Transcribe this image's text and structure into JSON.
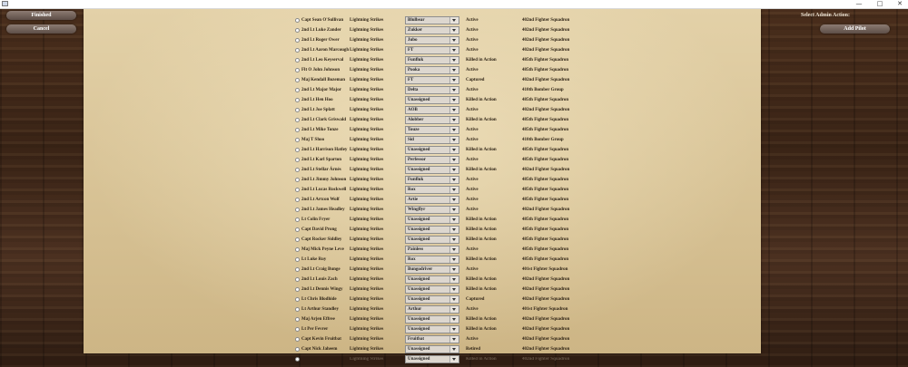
{
  "window": {
    "icon": "app-icon",
    "controls": {
      "minimize": "—",
      "maximize": "□",
      "close": "✕"
    }
  },
  "left_buttons": {
    "finished": "Finished",
    "cancel": "Cancel"
  },
  "admin": {
    "label": "Select Admin Action:",
    "add_pilot": "Add Pilot"
  },
  "roster": [
    {
      "name": "Capt Sean O'Sullivan",
      "unit": "Lightning Strikes",
      "callsign": "Blulbear",
      "status": "Active",
      "squadron": "402nd Fighter Squadron"
    },
    {
      "name": "2nd Lt Luke Zander",
      "unit": "Lightning Strikes",
      "callsign": "Zukker",
      "status": "Active",
      "squadron": "402nd Fighter Squadron"
    },
    {
      "name": "2nd Lt Roger Ower",
      "unit": "Lightning Strikes",
      "callsign": "Jubo",
      "status": "Active",
      "squadron": "402nd Fighter Squadron"
    },
    {
      "name": "2nd Lt Aaron Marcoughli",
      "unit": "Lightning Strikes",
      "callsign": "FT",
      "status": "Active",
      "squadron": "402nd Fighter Squadron"
    },
    {
      "name": "2nd Lt Leo Keyserval",
      "unit": "Lightning Strikes",
      "callsign": "Funfluk",
      "status": "Killed in Action",
      "squadron": "485th Fighter Squadron"
    },
    {
      "name": "Flt O John Johnson",
      "unit": "Lightning Strikes",
      "callsign": "Pooka",
      "status": "Active",
      "squadron": "485th Fighter Squadron"
    },
    {
      "name": "Maj Kendall Bozeman",
      "unit": "Lightning Strikes",
      "callsign": "FT",
      "status": "Captured",
      "squadron": "402nd Fighter Squadron"
    },
    {
      "name": "2nd Lt Major Major",
      "unit": "Lightning Strikes",
      "callsign": "Delta",
      "status": "Active",
      "squadron": "410th Bomber Group"
    },
    {
      "name": "2nd Lt Hen Hoo",
      "unit": "Lightning Strikes",
      "callsign": "Unassigned",
      "status": "Killed in Action",
      "squadron": "485th Fighter Squadron"
    },
    {
      "name": "2nd Lt Joe Splatt",
      "unit": "Lightning Strikes",
      "callsign": "AOB",
      "status": "Active",
      "squadron": "402nd Fighter Squadron"
    },
    {
      "name": "2nd Lt Clark Griswald",
      "unit": "Lightning Strikes",
      "callsign": "Alobber",
      "status": "Killed in Action",
      "squadron": "485th Fighter Squadron"
    },
    {
      "name": "2nd Lt Mike Tonze",
      "unit": "Lightning Strikes",
      "callsign": "Touze",
      "status": "Active",
      "squadron": "485th Fighter Squadron"
    },
    {
      "name": "Maj T Shoo",
      "unit": "Lightning Strikes",
      "callsign": "Sid",
      "status": "Active",
      "squadron": "410th Bomber Group"
    },
    {
      "name": "2nd Lt Harrison Hatley",
      "unit": "Lightning Strikes",
      "callsign": "Unassigned",
      "status": "Killed in Action",
      "squadron": "485th Fighter Squadron"
    },
    {
      "name": "2nd Lt Karl Sparton",
      "unit": "Lightning Strikes",
      "callsign": "Perfessor",
      "status": "Active",
      "squadron": "485th Fighter Squadron"
    },
    {
      "name": "2nd Lt Stellar Árnés",
      "unit": "Lightning Strikes",
      "callsign": "Unassigned",
      "status": "Killed in Action",
      "squadron": "402nd Fighter Squadron"
    },
    {
      "name": "2nd Lt Jimmy Johnson",
      "unit": "Lightning Strikes",
      "callsign": "Funfluk",
      "status": "Active",
      "squadron": "485th Fighter Squadron"
    },
    {
      "name": "2nd Lt Lucas Rockwell",
      "unit": "Lightning Strikes",
      "callsign": "Rox",
      "status": "Active",
      "squadron": "485th Fighter Squadron"
    },
    {
      "name": "2nd Lt Artcon Wolf",
      "unit": "Lightning Strikes",
      "callsign": "Artie",
      "status": "Active",
      "squadron": "485th Fighter Squadron"
    },
    {
      "name": "2nd Lt James Headley",
      "unit": "Lightning Strikes",
      "callsign": "Wingflyr",
      "status": "Active",
      "squadron": "402nd Fighter Squadron"
    },
    {
      "name": "Lt Colin Fryer",
      "unit": "Lightning Strikes",
      "callsign": "Unassigned",
      "status": "Killed in Action",
      "squadron": "485th Fighter Squadron"
    },
    {
      "name": "Capt David Prong",
      "unit": "Lightning Strikes",
      "callsign": "Unassigned",
      "status": "Killed in Action",
      "squadron": "485th Fighter Squadron"
    },
    {
      "name": "Capt Rocker Siddley",
      "unit": "Lightning Strikes",
      "callsign": "Unassigned",
      "status": "Killed in Action",
      "squadron": "485th Fighter Squadron"
    },
    {
      "name": "Maj Mick Peyne Leve",
      "unit": "Lightning Strikes",
      "callsign": "Painless",
      "status": "Active",
      "squadron": "485th Fighter Squadron"
    },
    {
      "name": "Lt Luke Roy",
      "unit": "Lightning Strikes",
      "callsign": "Rox",
      "status": "Killed in Action",
      "squadron": "485th Fighter Squadron"
    },
    {
      "name": "2nd Lt Craig Bunge",
      "unit": "Lightning Strikes",
      "callsign": "Bungodriver",
      "status": "Active",
      "squadron": "401st Fighter Squadron"
    },
    {
      "name": "2nd Lt Louis Zach",
      "unit": "Lightning Strikes",
      "callsign": "Unassigned",
      "status": "Killed in Action",
      "squadron": "402nd Fighter Squadron"
    },
    {
      "name": "2nd Lt Dennis Wingy",
      "unit": "Lightning Strikes",
      "callsign": "Unassigned",
      "status": "Killed in Action",
      "squadron": "402nd Fighter Squadron"
    },
    {
      "name": "Lt Chris Blodhide",
      "unit": "Lightning Strikes",
      "callsign": "Unassigned",
      "status": "Captured",
      "squadron": "402nd Fighter Squadron"
    },
    {
      "name": "Lt Arthur Standley",
      "unit": "Lightning Strikes",
      "callsign": "Arthur",
      "status": "Active",
      "squadron": "401st Fighter Squadron"
    },
    {
      "name": "Maj Arjen Effree",
      "unit": "Lightning Strikes",
      "callsign": "Unassigned",
      "status": "Killed in Action",
      "squadron": "402nd Fighter Squadron"
    },
    {
      "name": "Lt Per Fevrer",
      "unit": "Lightning Strikes",
      "callsign": "Unassigned",
      "status": "Killed in Action",
      "squadron": "402nd Fighter Squadron"
    },
    {
      "name": "Capt Kevin Fruitbat",
      "unit": "Lightning Strikes",
      "callsign": "Fruitbat",
      "status": "Active",
      "squadron": "402nd Fighter Squadron"
    },
    {
      "name": "Capt Nick Jaheem",
      "unit": "Lightning Strikes",
      "callsign": "Unassigned",
      "status": "Retired",
      "squadron": "402nd Fighter Squadron"
    },
    {
      "name": "",
      "unit": "Lightning Strikes",
      "callsign": "Unassigned",
      "status": "Killed in Action",
      "squadron": "402nd Fighter Squadron"
    }
  ]
}
